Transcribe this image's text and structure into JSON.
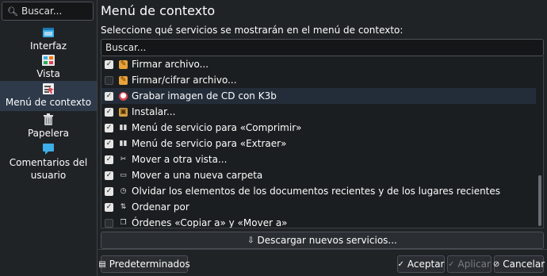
{
  "sidebar": {
    "search_placeholder": "Buscar...",
    "items": [
      {
        "label": "Interfaz",
        "icon": "folder-window-icon"
      },
      {
        "label": "Vista",
        "icon": "view-grid-icon"
      },
      {
        "label": "Menú de contexto",
        "icon": "context-menu-icon",
        "selected": true
      },
      {
        "label": "Papelera",
        "icon": "trash-icon"
      },
      {
        "label": "Comentarios del usuario",
        "icon": "chat-bubble-icon"
      }
    ]
  },
  "main": {
    "title": "Menú de contexto",
    "description": "Seleccione qué servicios se mostrarán en el menú de contexto:",
    "filter_placeholder": "Buscar...",
    "services": [
      {
        "label": "Firmar archivo...",
        "checked": true,
        "icon": "sign-icon"
      },
      {
        "label": "Firmar/cifrar archivo...",
        "checked": false,
        "icon": "encrypt-icon"
      },
      {
        "label": "Grabar imagen de CD con K3b",
        "checked": true,
        "icon": "k3b-disc-icon"
      },
      {
        "label": "Instalar...",
        "checked": true,
        "icon": "install-package-icon"
      },
      {
        "label": "Menú de servicio para «Comprimir»",
        "checked": true,
        "icon": "archive-compress-icon"
      },
      {
        "label": "Menú de servicio para «Extraer»",
        "checked": true,
        "icon": "archive-extract-icon"
      },
      {
        "label": "Mover a otra vista...",
        "checked": true,
        "icon": "cut-icon"
      },
      {
        "label": "Mover a una nueva carpeta",
        "checked": true,
        "icon": "new-folder-icon"
      },
      {
        "label": "Olvidar los elementos de los documentos recientes y de los lugares recientes",
        "checked": true,
        "icon": "forget-icon"
      },
      {
        "label": "Ordenar por",
        "checked": true,
        "icon": "sort-icon"
      },
      {
        "label": "Órdenes «Copiar a» y «Mover a»",
        "checked": false,
        "icon": "copy-icon"
      }
    ],
    "download_button": "Descargar nuevos servicios..."
  },
  "footer": {
    "defaults": "Predeterminados",
    "ok": "Aceptar",
    "apply": "Aplicar",
    "cancel": "Cancelar"
  },
  "colors": {
    "background": "#202326",
    "list_background": "#1b1e20",
    "selected": "#2e3a4a",
    "text": "#fcfcfc",
    "disabled_text": "#7a7d81"
  }
}
